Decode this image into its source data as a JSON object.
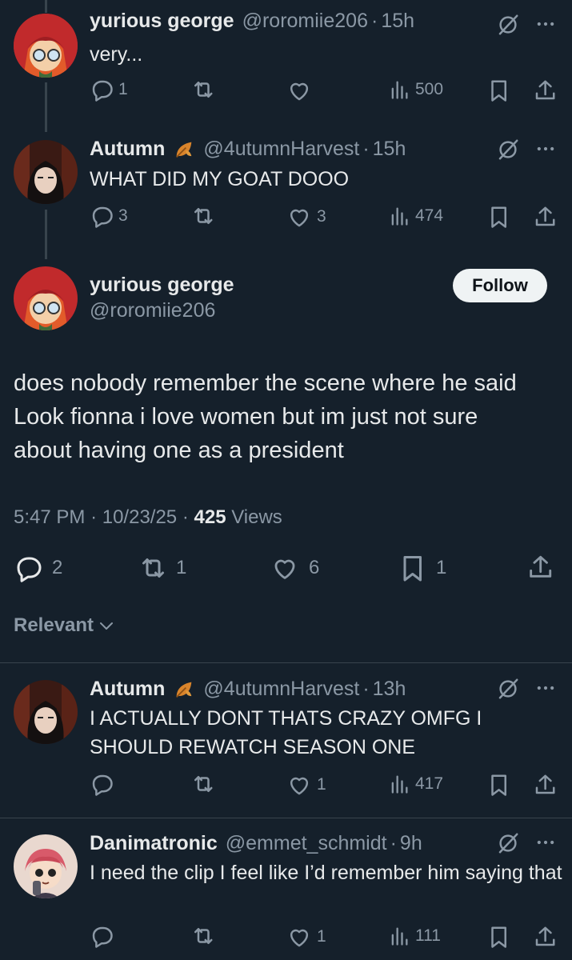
{
  "colors": {
    "background": "#15202b",
    "text": "#e7e9ea",
    "muted": "#8b98a5",
    "divider": "#38444d",
    "autumn_leaf": "#d9842b"
  },
  "thread": [
    {
      "name": "yurious george",
      "handle": "@roromiie206",
      "time": "15h",
      "text": "very...",
      "replies": "1",
      "retweets": "",
      "likes": "",
      "views": "500"
    },
    {
      "name": "Autumn",
      "name_emoji": "autumn-leaf-icon",
      "handle": "@4utumnHarvest",
      "time": "15h",
      "text": "WHAT DID MY GOAT DOOO",
      "replies": "3",
      "retweets": "",
      "likes": "3",
      "views": "474"
    }
  ],
  "main": {
    "name": "yurious george",
    "handle": "@roromiie206",
    "follow_label": "Follow",
    "text": "does nobody remember the scene where he said Look fionna i love women but im just not sure about having one as a president",
    "time": "5:47 PM",
    "date": "10/23/25",
    "views_count": "425",
    "views_label": "Views",
    "replies": "2",
    "retweets": "1",
    "likes": "6",
    "bookmarks": "1"
  },
  "sort_label": "Relevant",
  "replies": [
    {
      "name": "Autumn",
      "handle": "@4utumnHarvest",
      "time": "13h",
      "text": "I ACTUALLY DONT THATS CRAZY OMFG I SHOULD REWATCH SEASON ONE",
      "replies": "",
      "retweets": "",
      "likes": "1",
      "views": "417"
    },
    {
      "name": "Danimatronic",
      "handle": "@emmet_schmidt",
      "time": "9h",
      "text": "I need the clip I feel like I’d remember him saying that",
      "replies": "",
      "retweets": "",
      "likes": "1",
      "views": "111"
    }
  ],
  "separator": "·"
}
